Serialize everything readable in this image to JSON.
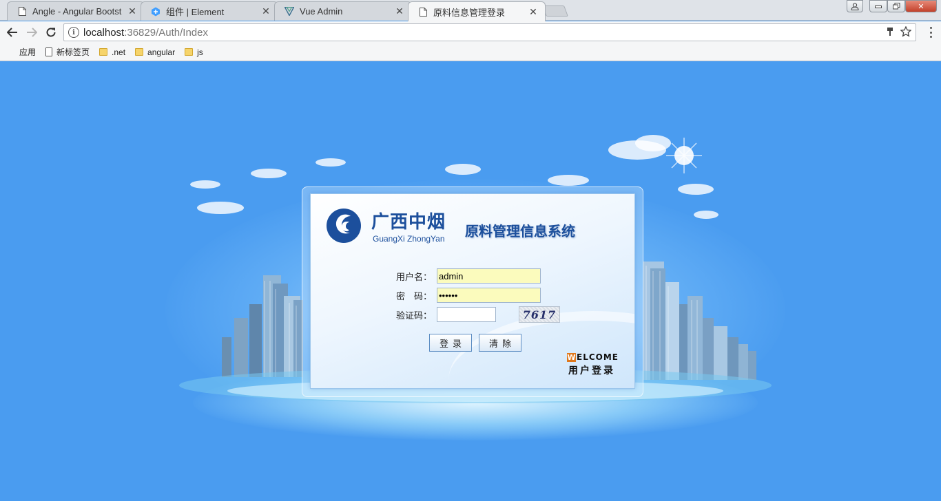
{
  "tabs": [
    {
      "title": "Angle - Angular Bootst",
      "icon": "page-icon"
    },
    {
      "title": "组件 | Element",
      "icon": "element-logo-icon"
    },
    {
      "title": "Vue Admin",
      "icon": "vue-logo-icon"
    },
    {
      "title": "原料信息管理登录",
      "icon": "page-icon",
      "active": true
    }
  ],
  "address_bar": {
    "host": "localhost",
    "rest": ":36829/Auth/Index"
  },
  "bookmarks": [
    {
      "label": "应用",
      "icon": "apps-icon"
    },
    {
      "label": "新标签页",
      "icon": "page-icon"
    },
    {
      "label": ".net",
      "icon": "folder-icon"
    },
    {
      "label": "angular",
      "icon": "folder-icon"
    },
    {
      "label": "js",
      "icon": "folder-icon"
    }
  ],
  "login": {
    "brand_cn": "广西中烟",
    "brand_en": "GuangXi ZhongYan",
    "system_title": "原料管理信息系统",
    "username_label": "用户名：",
    "username_value": "admin",
    "password_label": "密　码：",
    "password_value": "••••••",
    "captcha_label": "验证码：",
    "captcha_value": "",
    "captcha_text": "7617",
    "login_button": "登录",
    "clear_button": "清除",
    "welcome_initial": "W",
    "welcome_rest": "ELCOME",
    "welcome_sub": "用户登录"
  },
  "colors": {
    "page_background": "#4a9cf0",
    "brand_blue": "#1c4f9c",
    "autofill_yellow": "#fbfbbd"
  }
}
